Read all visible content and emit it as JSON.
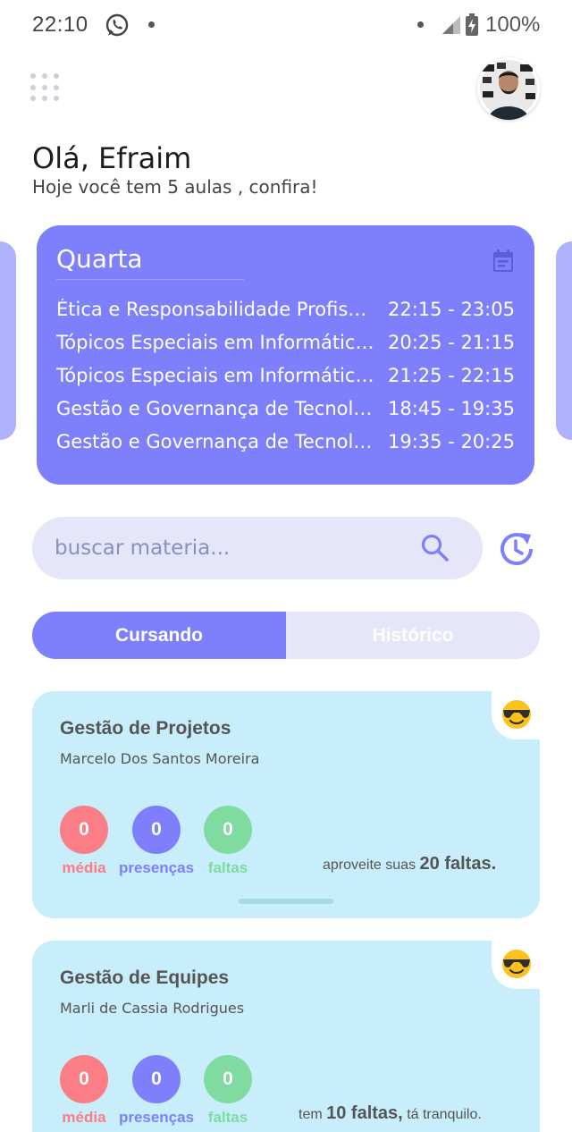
{
  "status_bar": {
    "time": "22:10",
    "battery": "100%"
  },
  "header": {
    "greeting": "Olá, Efraim",
    "subtitle": "Hoje você tem 5 aulas , confira!"
  },
  "schedule": {
    "day": "Quarta",
    "classes": [
      {
        "name": "Ética e Responsabilidade Profissional",
        "time": "22:15 - 23:05"
      },
      {
        "name": "Tópicos Especiais em Informática (Engenharia)",
        "time": "20:25 - 21:15"
      },
      {
        "name": "Tópicos Especiais em Informática (Engenharia)",
        "time": "21:25 - 22:15"
      },
      {
        "name": "Gestão e Governança de Tecnologia da Informação",
        "time": "18:45 - 19:35"
      },
      {
        "name": "Gestão e Governança de Tecnologia da Informação",
        "time": "19:35 - 20:25"
      }
    ]
  },
  "search": {
    "placeholder": "buscar materia..."
  },
  "tabs": {
    "active": "Cursando",
    "inactive": "Histórico"
  },
  "courses": [
    {
      "title": "Gestão de Projetos",
      "teacher": "Marcelo Dos Santos Moreira",
      "media": "0",
      "presencas": "0",
      "faltas": "0",
      "labels": {
        "media": "média",
        "presencas": "presenças",
        "faltas": "faltas"
      },
      "note_pre": "aproveite suas",
      "note_bold": "20 faltas.",
      "note_post": ""
    },
    {
      "title": "Gestão de Equipes",
      "teacher": "Marli de Cassia Rodrigues",
      "media": "0",
      "presencas": "0",
      "faltas": "0",
      "labels": {
        "media": "média",
        "presencas": "presenças",
        "faltas": "faltas"
      },
      "note_pre": "tem",
      "note_bold": "10 faltas,",
      "note_post": "tá tranquilo."
    }
  ],
  "colors": {
    "accent": "#7e80fb",
    "media": "#fb7e86",
    "faltas": "#7fdb9f",
    "card_bg": "#c8eefc"
  },
  "icons": {
    "menu": "grid-dots-icon",
    "calendar": "calendar-icon",
    "search": "search-icon",
    "history": "history-icon",
    "emoji": "sunglasses-emoji-icon"
  }
}
